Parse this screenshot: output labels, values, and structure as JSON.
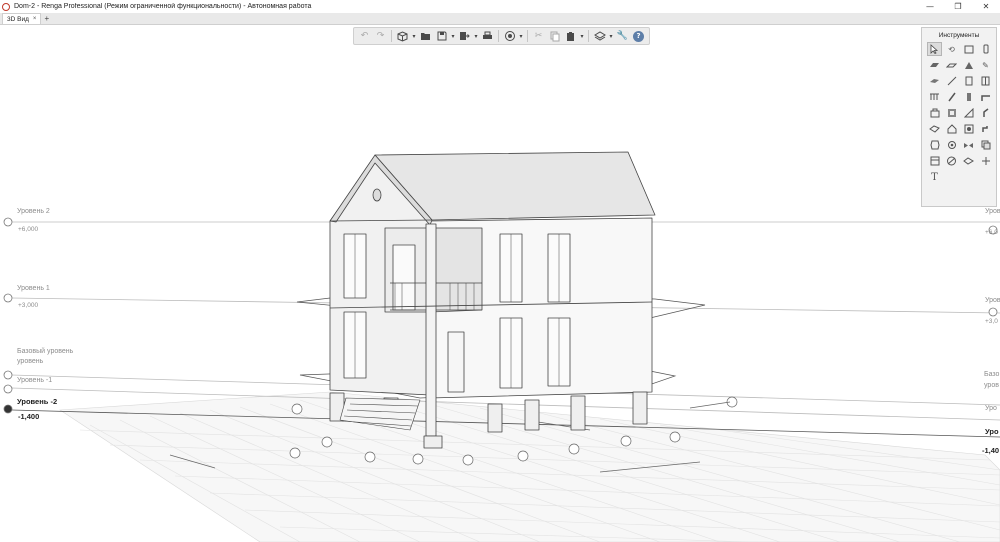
{
  "window": {
    "title": "Dom-2 - Renga Professional (Режим ограниченной функциональности) - Автономная работа",
    "minimize_glyph": "—",
    "maximize_glyph": "❐",
    "close_glyph": "✕"
  },
  "tabs": [
    {
      "label": "3D Вид",
      "close": "×"
    }
  ],
  "tab_add": "+",
  "toolbar": {
    "undo_icon": "undo-icon",
    "redo_icon": "redo-icon",
    "help_label": "?"
  },
  "instruments": {
    "title": "Инструменты",
    "text_tool_label": "T"
  },
  "levels_left": [
    {
      "name": "Уровень 2",
      "elevation": "+6,000"
    },
    {
      "name": "Уровень 1",
      "elevation": "+3,000"
    },
    {
      "name": "Базовый уровень",
      "line2": "уровень"
    },
    {
      "name": "Уровень -1"
    },
    {
      "name": "Уровень -2",
      "elevation": "-1,400"
    }
  ],
  "levels_right": [
    {
      "name": "Уров",
      "elevation": "+6,0"
    },
    {
      "name": "Уров",
      "elevation": "+3,0"
    },
    {
      "name": "Базо",
      "line2": "уров"
    },
    {
      "name": "Уро"
    },
    {
      "name": "Уро"
    },
    {
      "name": "-1,40"
    }
  ],
  "colors": {
    "level_line": "#b8b8b8",
    "grid": "#e4e4e4",
    "wall": "#f4f4f4",
    "edge": "#444444",
    "accent": "#5d7ea8"
  }
}
